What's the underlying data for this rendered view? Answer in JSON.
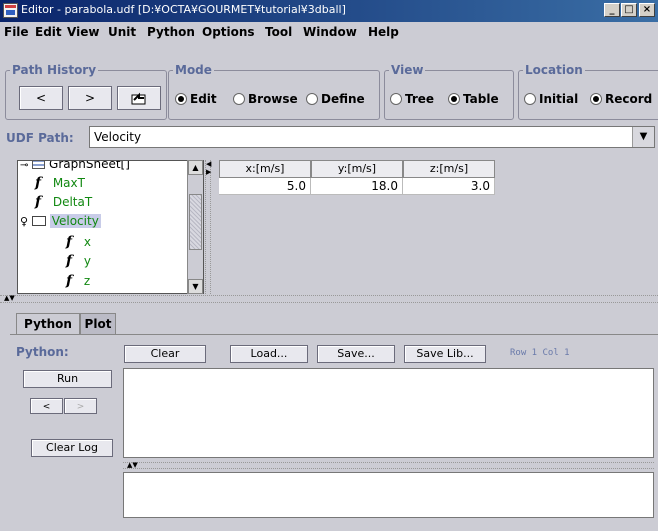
{
  "window": {
    "title": "Editor - parabola.udf [D:¥OCTA¥GOURMET¥tutorial¥3dball]",
    "controls": [
      "_",
      "□",
      "×"
    ]
  },
  "menu": [
    "File",
    "Edit",
    "View",
    "Unit",
    "Python",
    "Options",
    "Tool",
    "Window",
    "Help"
  ],
  "path_history": {
    "title": "Path History",
    "back": "<",
    "forward": ">"
  },
  "mode": {
    "title": "Mode",
    "options": [
      "Edit",
      "Browse",
      "Define"
    ],
    "selected": "Edit"
  },
  "view": {
    "title": "View",
    "options": [
      "Tree",
      "Table"
    ],
    "selected": "Table"
  },
  "location": {
    "title": "Location",
    "options": [
      "Initial",
      "Record"
    ],
    "selected": "Record"
  },
  "udf_path": {
    "label": "UDF Path:",
    "value": "Velocity"
  },
  "tree": {
    "items": [
      {
        "label": "GraphSheet[]",
        "type": "table"
      },
      {
        "label": "MaxT",
        "type": "function"
      },
      {
        "label": "DeltaT",
        "type": "function"
      },
      {
        "label": "Velocity",
        "type": "folder",
        "selected": true
      },
      {
        "label": "x",
        "type": "function"
      },
      {
        "label": "y",
        "type": "function"
      },
      {
        "label": "z",
        "type": "function"
      }
    ]
  },
  "table": {
    "columns": [
      "x:[m/s]",
      "y:[m/s]",
      "z:[m/s]"
    ],
    "rows": [
      [
        "5.0",
        "18.0",
        "3.0"
      ]
    ]
  },
  "tabs": [
    "Python",
    "Plot"
  ],
  "active_tab": "Python",
  "python": {
    "label": "Python:",
    "buttons": {
      "clear": "Clear",
      "load": "Load...",
      "save": "Save...",
      "save_lib": "Save Lib..."
    },
    "status": "Row 1 Col 1",
    "run": "Run",
    "prev": "<",
    "next": ">",
    "clear_log": "Clear Log"
  }
}
